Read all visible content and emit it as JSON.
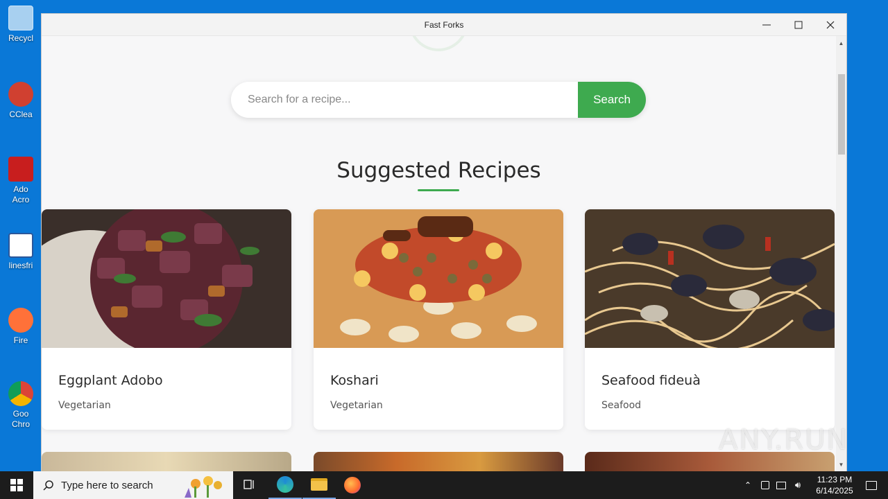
{
  "desktop": {
    "icons": [
      {
        "label": "Recycl",
        "color": "#7fb8e8"
      },
      {
        "label": "CClea",
        "color": "#d04030"
      },
      {
        "label": "Ado\nAcro",
        "color": "#c81e1e"
      },
      {
        "label": "linesfri",
        "color": "#2b579a"
      },
      {
        "label": "Fire",
        "color": "#ff7139"
      },
      {
        "label": "Goo\nChro",
        "color": "#2a9d4a"
      }
    ]
  },
  "window": {
    "title": "Fast Forks",
    "minimize_icon": "minimize-icon",
    "maximize_icon": "maximize-icon",
    "close_icon": "close-icon"
  },
  "search": {
    "placeholder": "Search for a recipe...",
    "value": "",
    "button_label": "Search"
  },
  "section": {
    "title": "Suggested Recipes"
  },
  "recipes": [
    {
      "name": "Eggplant Adobo",
      "category": "Vegetarian"
    },
    {
      "name": "Koshari",
      "category": "Vegetarian"
    },
    {
      "name": "Seafood fideuà",
      "category": "Seafood"
    }
  ],
  "taskbar": {
    "search_placeholder": "Type here to search",
    "time": "11:23 PM",
    "date": "6/14/2025"
  },
  "watermark": "ANY.RUN",
  "colors": {
    "accent": "#3eaa4f",
    "desktop": "#0a78d7",
    "taskbar": "#1c1c1c"
  }
}
